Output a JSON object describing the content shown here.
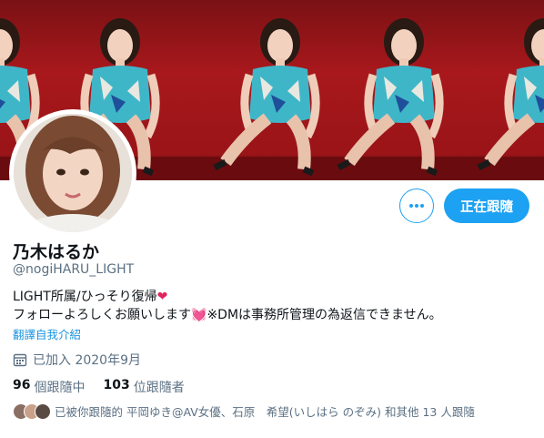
{
  "profile": {
    "display_name": "乃木はるか",
    "handle": "@nogiHARU_LIGHT",
    "bio_line1": "LIGHT所属/ひっそり復帰",
    "bio_line2_a": "フォローよろしくお願いします",
    "bio_line2_b": "※DMは事務所管理の為返信できません。",
    "translate_link": "翻譯自我介紹",
    "joined": "已加入 2020年9月"
  },
  "buttons": {
    "following": "正在跟隨",
    "more": "•••"
  },
  "stats": {
    "following_count": "96",
    "following_label": "個跟隨中",
    "followers_count": "103",
    "followers_label": "位跟隨者"
  },
  "followers_you_know": "已被你跟隨的 平岡ゆき@AV女優、石原　希望(いしはら のぞみ) 和其他 13 人跟隨",
  "colors": {
    "accent": "#1da1f2",
    "banner_red": "#a3171b",
    "heart": "#e0245e"
  },
  "icons": {
    "more": "more-dots-icon",
    "calendar": "calendar-icon",
    "heart": "heart-icon"
  }
}
